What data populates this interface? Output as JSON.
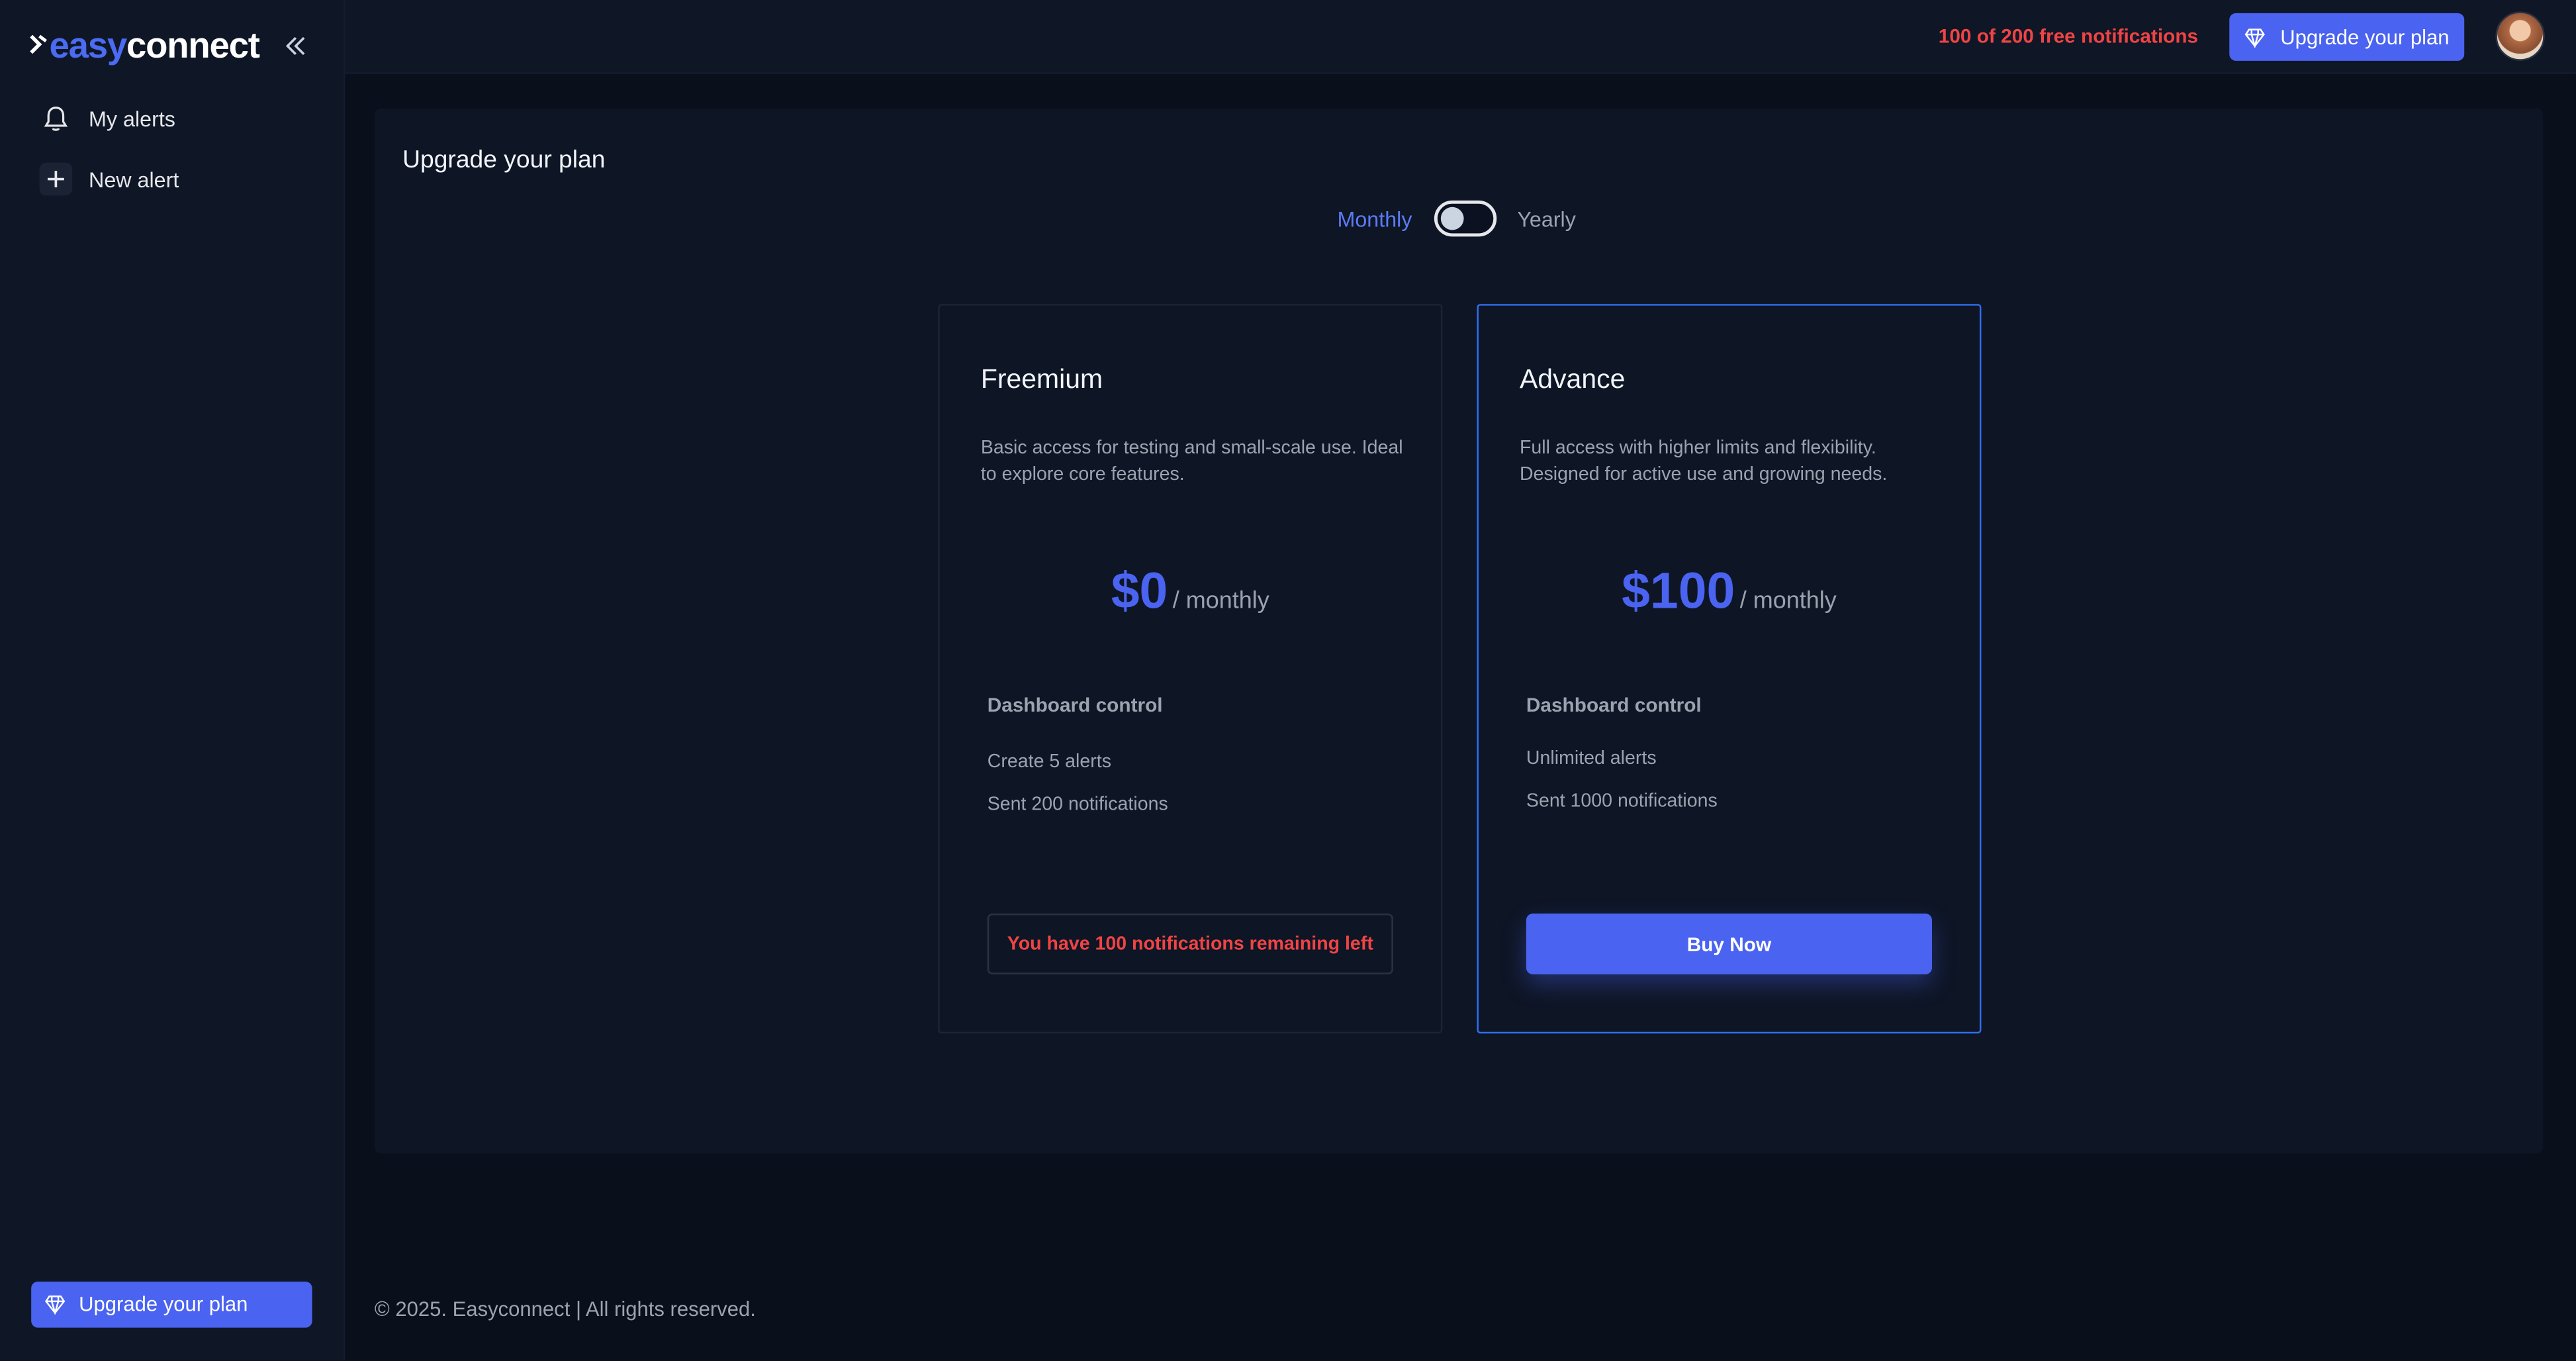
{
  "app": {
    "logo_easy": "easy",
    "logo_connect": "connect"
  },
  "sidebar": {
    "items": [
      {
        "label": "My alerts",
        "icon": "bell-icon"
      },
      {
        "label": "New alert",
        "icon": "plus-icon"
      }
    ],
    "upgrade_label": "Upgrade your plan"
  },
  "topbar": {
    "quota_text": "100 of 200 free notifications",
    "upgrade_label": "Upgrade your plan"
  },
  "main": {
    "title": "Upgrade your plan",
    "billing": {
      "monthly_label": "Monthly",
      "yearly_label": "Yearly",
      "selected": "Monthly"
    },
    "plans": [
      {
        "name": "Freemium",
        "description": "Basic access for testing and small-scale use. Ideal to explore core features.",
        "price": "$0",
        "period": "/ monthly",
        "features_heading": "Dashboard control",
        "features": [
          "Create 5 alerts",
          "Sent 200 notifications"
        ],
        "status_text": "You have 100 notifications remaining left"
      },
      {
        "name": "Advance",
        "description": "Full access with higher limits and flexibility. Designed for active use and growing needs.",
        "price": "$100",
        "period": "/ monthly",
        "features_heading": "Dashboard control",
        "features": [
          "Unlimited alerts",
          "Sent 1000 notifications"
        ],
        "cta_label": "Buy Now"
      }
    ]
  },
  "footer": {
    "text": "© 2025. Easyconnect | All rights reserved."
  },
  "colors": {
    "accent": "#4a63f0",
    "warning": "#ef4444",
    "selected_border": "#2f6ff0",
    "background": "#0a0f1c"
  }
}
